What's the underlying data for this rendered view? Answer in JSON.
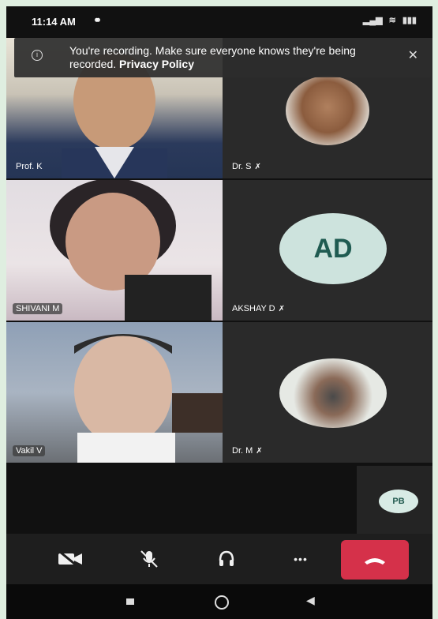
{
  "status": {
    "time": "11:14 AM",
    "alarm_icon": "headphones-icon",
    "signal": "signal-icon",
    "wifi": "wifi-icon",
    "battery": "battery-icon"
  },
  "banner": {
    "message": "You're recording. Make sure everyone knows they're being recorded. ",
    "link": "Privacy Policy"
  },
  "participants": [
    {
      "label": "Prof. K",
      "kind": "video"
    },
    {
      "label": "Dr. S",
      "kind": "avatar",
      "muted": true
    },
    {
      "label": "SHIVANI M",
      "kind": "video"
    },
    {
      "label": "AKSHAY D",
      "kind": "initials",
      "initials": "AD",
      "muted": true
    },
    {
      "label": "Vakil V",
      "kind": "video"
    },
    {
      "label": "Dr. M",
      "kind": "avatar",
      "muted": true
    }
  ],
  "self_tile": {
    "initials": "PB"
  },
  "controls": [
    {
      "name": "camera-off-icon"
    },
    {
      "name": "mic-off-icon"
    },
    {
      "name": "headset-icon"
    },
    {
      "name": "more-icon",
      "text": "•••"
    },
    {
      "name": "end-call-icon"
    }
  ],
  "colors": {
    "end_call": "#d5314a",
    "avatar_bg": "#cde3dd",
    "avatar_text": "#1f5b51"
  }
}
